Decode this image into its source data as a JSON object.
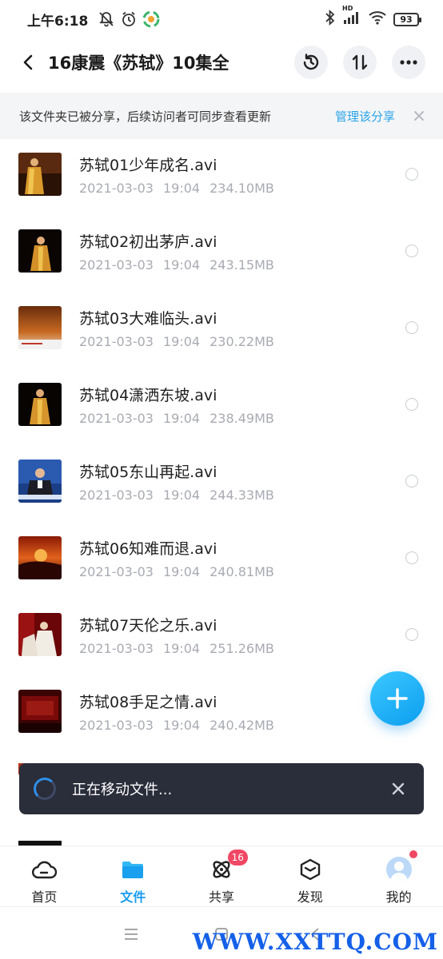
{
  "status_bar": {
    "time": "上午6:18",
    "battery": "93",
    "network": "HD"
  },
  "header": {
    "title": "16康震《苏轼》10集全"
  },
  "banner": {
    "text": "该文件夹已被分享，后续访问者可同步查看更新",
    "manage_link": "管理该分享"
  },
  "files": [
    {
      "name": "苏轼01少年成名.avi",
      "date": "2021-03-03",
      "time": "19:04",
      "size": "234.10MB"
    },
    {
      "name": "苏轼02初出茅庐.avi",
      "date": "2021-03-03",
      "time": "19:04",
      "size": "243.15MB"
    },
    {
      "name": "苏轼03大难临头.avi",
      "date": "2021-03-03",
      "time": "19:04",
      "size": "230.22MB"
    },
    {
      "name": "苏轼04潇洒东坡.avi",
      "date": "2021-03-03",
      "time": "19:04",
      "size": "238.49MB"
    },
    {
      "name": "苏轼05东山再起.avi",
      "date": "2021-03-03",
      "time": "19:04",
      "size": "244.33MB"
    },
    {
      "name": "苏轼06知难而退.avi",
      "date": "2021-03-03",
      "time": "19:04",
      "size": "240.81MB"
    },
    {
      "name": "苏轼07天伦之乐.avi",
      "date": "2021-03-03",
      "time": "19:04",
      "size": "251.26MB"
    },
    {
      "name": "苏轼08手足之情.avi",
      "date": "2021-03-03",
      "time": "19:04",
      "size": "240.42MB"
    }
  ],
  "toast": {
    "text": "正在移动文件..."
  },
  "bottom_nav": {
    "items": [
      {
        "label": "首页"
      },
      {
        "label": "文件"
      },
      {
        "label": "共享",
        "badge": "16"
      },
      {
        "label": "发现"
      },
      {
        "label": "我的"
      }
    ],
    "active": "文件"
  },
  "watermark": "WWW.XXTTQ.COM",
  "colors": {
    "accent": "#1a9cf0",
    "link": "#2aa4e8",
    "badge": "#f04864",
    "toast_bg": "#2a2d3a"
  }
}
